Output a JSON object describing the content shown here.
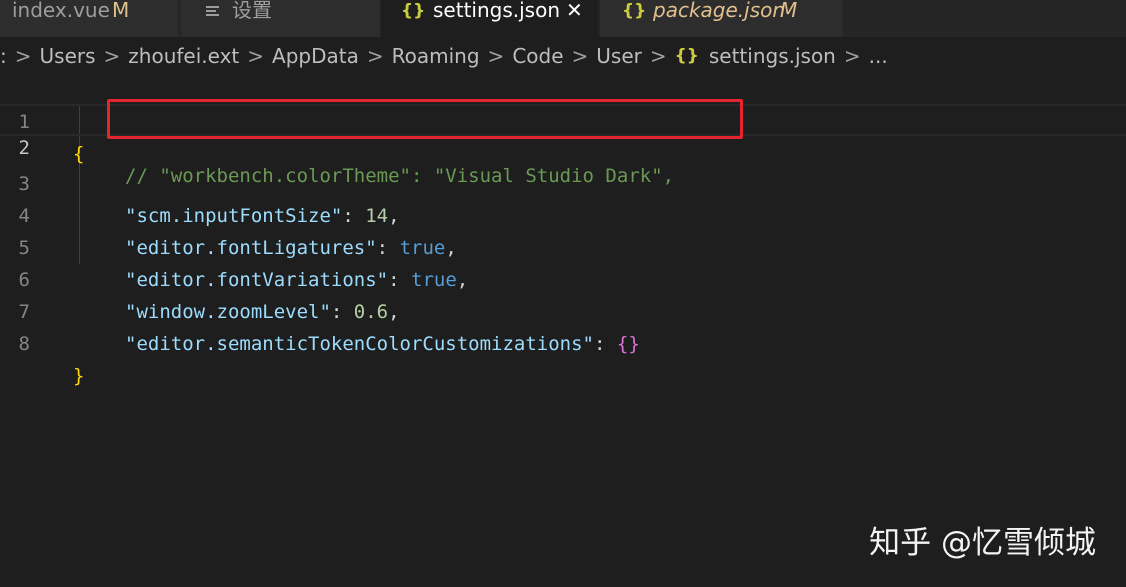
{
  "tabs": [
    {
      "label": "index.vue",
      "badge": "M"
    },
    {
      "icon": "settings-lines-icon",
      "label": "设置"
    },
    {
      "icon": "json-braces-icon",
      "icon_glyph": "{}",
      "label": "settings.json",
      "close": "✕",
      "active": true
    },
    {
      "icon": "json-braces-icon",
      "icon_glyph": "{}",
      "label": "package.json",
      "badge": "M"
    }
  ],
  "breadcrumb": {
    "lead": ":",
    "items": [
      "Users",
      "zhoufei.ext",
      "AppData",
      "Roaming",
      "Code",
      "User"
    ],
    "file_icon": "{}",
    "file": "settings.json",
    "tail": "...",
    "separator": ">"
  },
  "editor": {
    "current_line": 2,
    "lines": [
      {
        "n": "1"
      },
      {
        "n": "2"
      },
      {
        "n": "3"
      },
      {
        "n": "4"
      },
      {
        "n": "5"
      },
      {
        "n": "6"
      },
      {
        "n": "7"
      },
      {
        "n": "8"
      }
    ],
    "tokens": {
      "open_brace": "{",
      "comment": "// \"workbench.colorTheme\": \"Visual Studio Dark\",",
      "k_scm": "\"scm.inputFontSize\"",
      "v_scm": "14",
      "k_lig": "\"editor.fontLigatures\"",
      "v_lig": "true",
      "k_var": "\"editor.fontVariations\"",
      "v_var": "true",
      "k_zoom": "\"window.zoomLevel\"",
      "v_zoom": "0.6",
      "k_sem": "\"editor.semanticTokenColorCustomizations\"",
      "v_sem": "{}",
      "close_brace": "}",
      "colon": ": ",
      "comma": ","
    }
  },
  "watermark": "知乎 @忆雪倾城",
  "colors": {
    "background": "#1e1e1e",
    "key": "#9cdcfe",
    "number": "#b5cea8",
    "boolean": "#569cd6",
    "comment": "#6a9955",
    "highlight_box": "#e3262e"
  }
}
